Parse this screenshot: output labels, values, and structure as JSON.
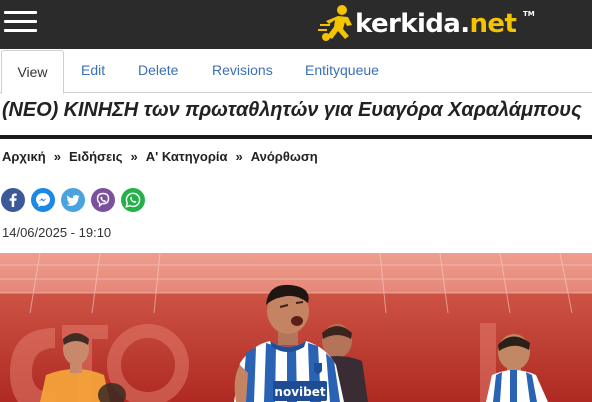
{
  "header": {
    "logo_text_white": "kerkida.",
    "logo_text_yellow": "net",
    "logo_tm": "TM"
  },
  "tabs": [
    {
      "label": "View",
      "active": true
    },
    {
      "label": "Edit",
      "active": false
    },
    {
      "label": "Delete",
      "active": false
    },
    {
      "label": "Revisions",
      "active": false
    },
    {
      "label": "Entityqueue",
      "active": false
    }
  ],
  "article": {
    "title": "(ΝΕΟ) ΚΙΝΗΣΗ των πρωταθλητών για Ευαγόρα Χαραλάμπους",
    "date": "14/06/2025 - 19:10",
    "image_sponsor_text": "novibet"
  },
  "breadcrumb": {
    "items": [
      "Αρχική",
      "Ειδήσεις",
      "Α' Κατηγορία",
      "Ανόρθωση"
    ],
    "separator": "»"
  },
  "share": {
    "buttons": [
      {
        "icon": "facebook-icon",
        "color": "#3b5998"
      },
      {
        "icon": "messenger-icon",
        "color": "#1e88e5"
      },
      {
        "icon": "twitter-icon",
        "color": "#4aa3df"
      },
      {
        "icon": "viber-icon",
        "color": "#7b519d"
      },
      {
        "icon": "whatsapp-icon",
        "color": "#25b04a"
      }
    ]
  },
  "colors": {
    "header_bg": "#2b2b2b",
    "logo_yellow": "#f5c400",
    "tab_link": "#3b6fb6",
    "hero_red": "#c0392b"
  }
}
